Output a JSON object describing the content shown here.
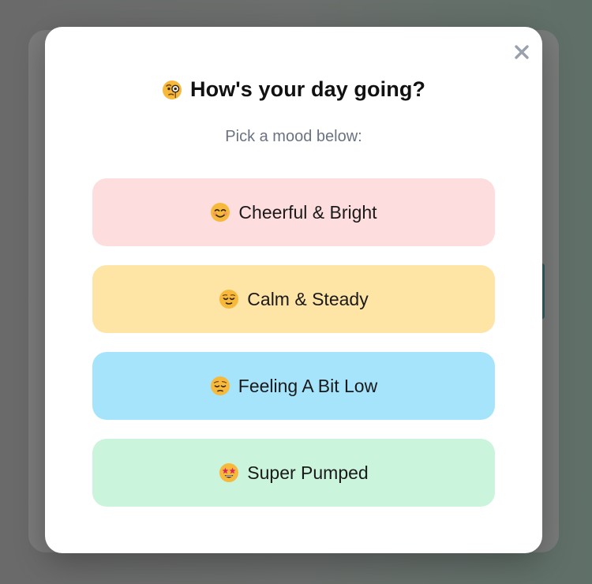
{
  "dialog": {
    "title": "How's your day going?",
    "title_icon": "face-with-monocle-icon",
    "subtitle": "Pick a mood below:",
    "close_icon": "close-icon"
  },
  "moods": [
    {
      "label": "Cheerful & Bright",
      "icon": "smiling-face-icon",
      "color": "#fddddd"
    },
    {
      "label": "Calm & Steady",
      "icon": "relieved-face-icon",
      "color": "#fee4a5"
    },
    {
      "label": "Feeling A Bit Low",
      "icon": "pensive-face-icon",
      "color": "#a6e4fc"
    },
    {
      "label": "Super Pumped",
      "icon": "star-struck-icon",
      "color": "#caf5dc"
    }
  ],
  "colors": {
    "overlay": "#6b6e6c",
    "modal_bg": "#ffffff",
    "title": "#111111",
    "subtitle": "#6b7280",
    "close": "#9aa1ab"
  }
}
